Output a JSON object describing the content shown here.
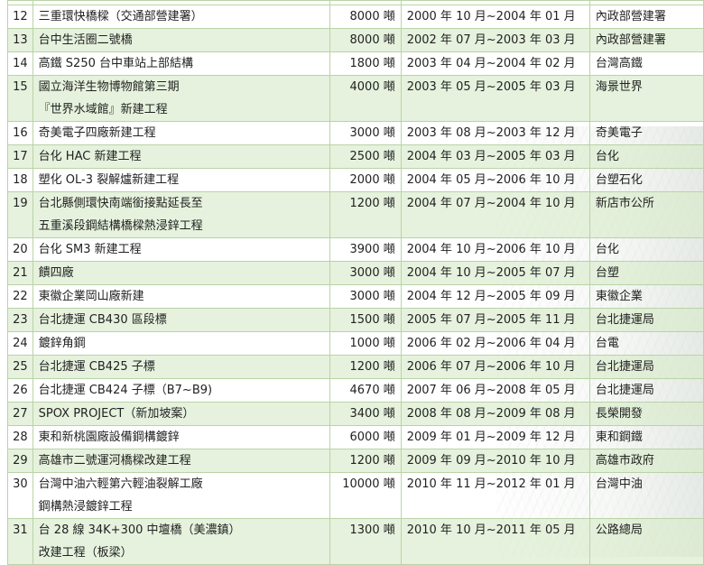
{
  "table": {
    "rows": [
      {
        "no": "12",
        "name": [
          "三重環快橋樑（交通部營建署）"
        ],
        "tonnage": "8000 噸",
        "period": "2000 年 10 月~2004 年 01 月",
        "owner": "內政部營建署"
      },
      {
        "no": "13",
        "name": [
          "台中生活圈二號橋"
        ],
        "tonnage": "8000 噸",
        "period": "2002 年 07 月~2003 年 03 月",
        "owner": "內政部營建署"
      },
      {
        "no": "14",
        "name": [
          "高鐵 S250 台中車站上部結構"
        ],
        "tonnage": "1800 噸",
        "period": "2003 年 04 月~2004 年 02 月",
        "owner": "台灣高鐵"
      },
      {
        "no": "15",
        "name": [
          "國立海洋生物博物館第三期",
          "『世界水域館』新建工程"
        ],
        "tonnage": "4000 噸",
        "period": "2003 年 05 月~2005 年 03 月",
        "owner": "海景世界"
      },
      {
        "no": "16",
        "name": [
          "奇美電子四廠新建工程"
        ],
        "tonnage": "3000 噸",
        "period": "2003 年 08 月~2003 年 12 月",
        "owner": "奇美電子"
      },
      {
        "no": "17",
        "name": [
          "台化 HAC 新建工程"
        ],
        "tonnage": "2500 噸",
        "period": "2004 年 03 月~2005 年 03 月",
        "owner": "台化"
      },
      {
        "no": "18",
        "name": [
          "塑化 OL-3 裂解爐新建工程"
        ],
        "tonnage": "2000 噸",
        "period": "2004 年 05 月~2006 年 10 月",
        "owner": "台塑石化"
      },
      {
        "no": "19",
        "name": [
          "台北縣側環快南端銜接點延長至",
          "五重溪段鋼結構橋樑熱浸鋅工程"
        ],
        "tonnage": "1200 噸",
        "period": "2004 年 07 月~2004 年 10 月",
        "owner": "新店市公所"
      },
      {
        "no": "20",
        "name": [
          "台化 SM3 新建工程"
        ],
        "tonnage": "3900 噸",
        "period": "2004 年 10 月~2006 年 10 月",
        "owner": "台化"
      },
      {
        "no": "21",
        "name": [
          "饋四廠"
        ],
        "tonnage": "3000 噸",
        "period": "2004 年 10 月~2005 年 07 月",
        "owner": "台塑"
      },
      {
        "no": "22",
        "name": [
          "東徽企業岡山廠新建"
        ],
        "tonnage": "3000 噸",
        "period": "2004 年 12 月~2005 年 09 月",
        "owner": "東徽企業"
      },
      {
        "no": "23",
        "name": [
          "台北捷運 CB430 區段標"
        ],
        "tonnage": "1500 噸",
        "period": "2005 年 07 月~2005 年 11 月",
        "owner": "台北捷運局"
      },
      {
        "no": "24",
        "name": [
          "鍍鋅角鋼"
        ],
        "tonnage": "1000 噸",
        "period": "2006 年 02 月~2006 年 04 月",
        "owner": "台電"
      },
      {
        "no": "25",
        "name": [
          "台北捷運 CB425 子標"
        ],
        "tonnage": "1200 噸",
        "period": "2006 年 07 月~2006 年 10 月",
        "owner": "台北捷運局"
      },
      {
        "no": "26",
        "name": [
          "台北捷運 CB424 子標（B7~B9)"
        ],
        "tonnage": "4670 噸",
        "period": "2007 年 06 月~2008 年 05 月",
        "owner": "台北捷運局"
      },
      {
        "no": "27",
        "name": [
          "SPOX PROJECT（新加坡案）"
        ],
        "tonnage": "3400 噸",
        "period": "2008 年 08 月~2009 年 08 月",
        "owner": "長榮開發"
      },
      {
        "no": "28",
        "name": [
          "東和新桃園廠設備鋼構鍍鋅"
        ],
        "tonnage": "6000 噸",
        "period": "2009 年 01 月~2009 年 12 月",
        "owner": "東和鋼鐵"
      },
      {
        "no": "29",
        "name": [
          "高雄市二號運河橋樑改建工程"
        ],
        "tonnage": "1200 噸",
        "period": "2009 年 09 月~2010 年 10 月",
        "owner": "高雄市政府"
      },
      {
        "no": "30",
        "name": [
          "台灣中油六輕第六輕油裂解工廠",
          "鋼構熱浸鍍鋅工程"
        ],
        "tonnage": "10000 噸",
        "period": "2010 年 11 月~2012 年 01 月",
        "owner": "台灣中油"
      },
      {
        "no": "31",
        "name": [
          "台 28 線 34K+300 中壇橋（美濃鎮）",
          "改建工程（板梁）"
        ],
        "tonnage": "1300 噸",
        "period": "2010 年 10 月~2011 年 05 月",
        "owner": "公路總局"
      }
    ]
  }
}
